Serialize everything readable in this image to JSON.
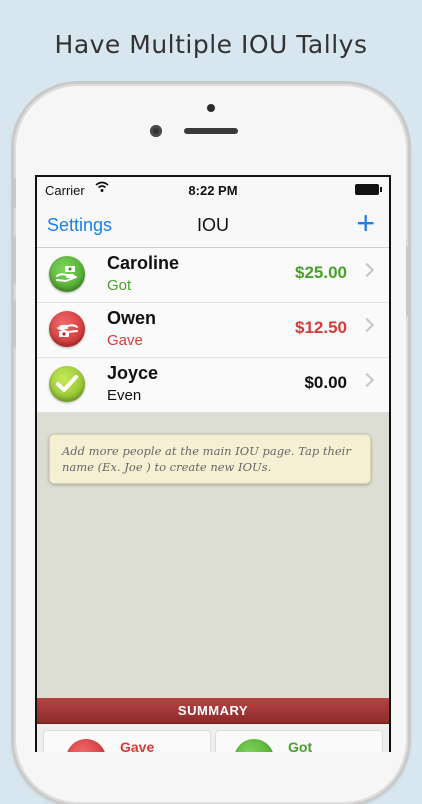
{
  "headline": "Have Multiple IOU Tallys",
  "status_bar": {
    "carrier": "Carrier",
    "time": "8:22 PM"
  },
  "nav": {
    "left_label": "Settings",
    "title": "IOU",
    "add_label": "+"
  },
  "people": [
    {
      "name": "Caroline",
      "status": "Got",
      "amount": "$25.00",
      "status_color": "#4aa02c",
      "amount_color": "#4aa02c",
      "icon": "hand-money-got-icon"
    },
    {
      "name": "Owen",
      "status": "Gave",
      "amount": "$12.50",
      "status_color": "#d93a3a",
      "amount_color": "#d93a3a",
      "icon": "hand-money-gave-icon"
    },
    {
      "name": "Joyce",
      "status": "Even",
      "amount": "$0.00",
      "status_color": "#111111",
      "amount_color": "#111111",
      "icon": "checkmark-icon"
    }
  ],
  "hint": "Add more people at the main IOU page. Tap their name (Ex. Joe ) to create new IOUs.",
  "summary": {
    "title": "SUMMARY",
    "gave_label": "Gave",
    "got_label": "Got"
  },
  "colors": {
    "accent": "#1a7fe8",
    "got": "#4aa02c",
    "gave": "#d93a3a",
    "summary_bar": "#a33838"
  }
}
